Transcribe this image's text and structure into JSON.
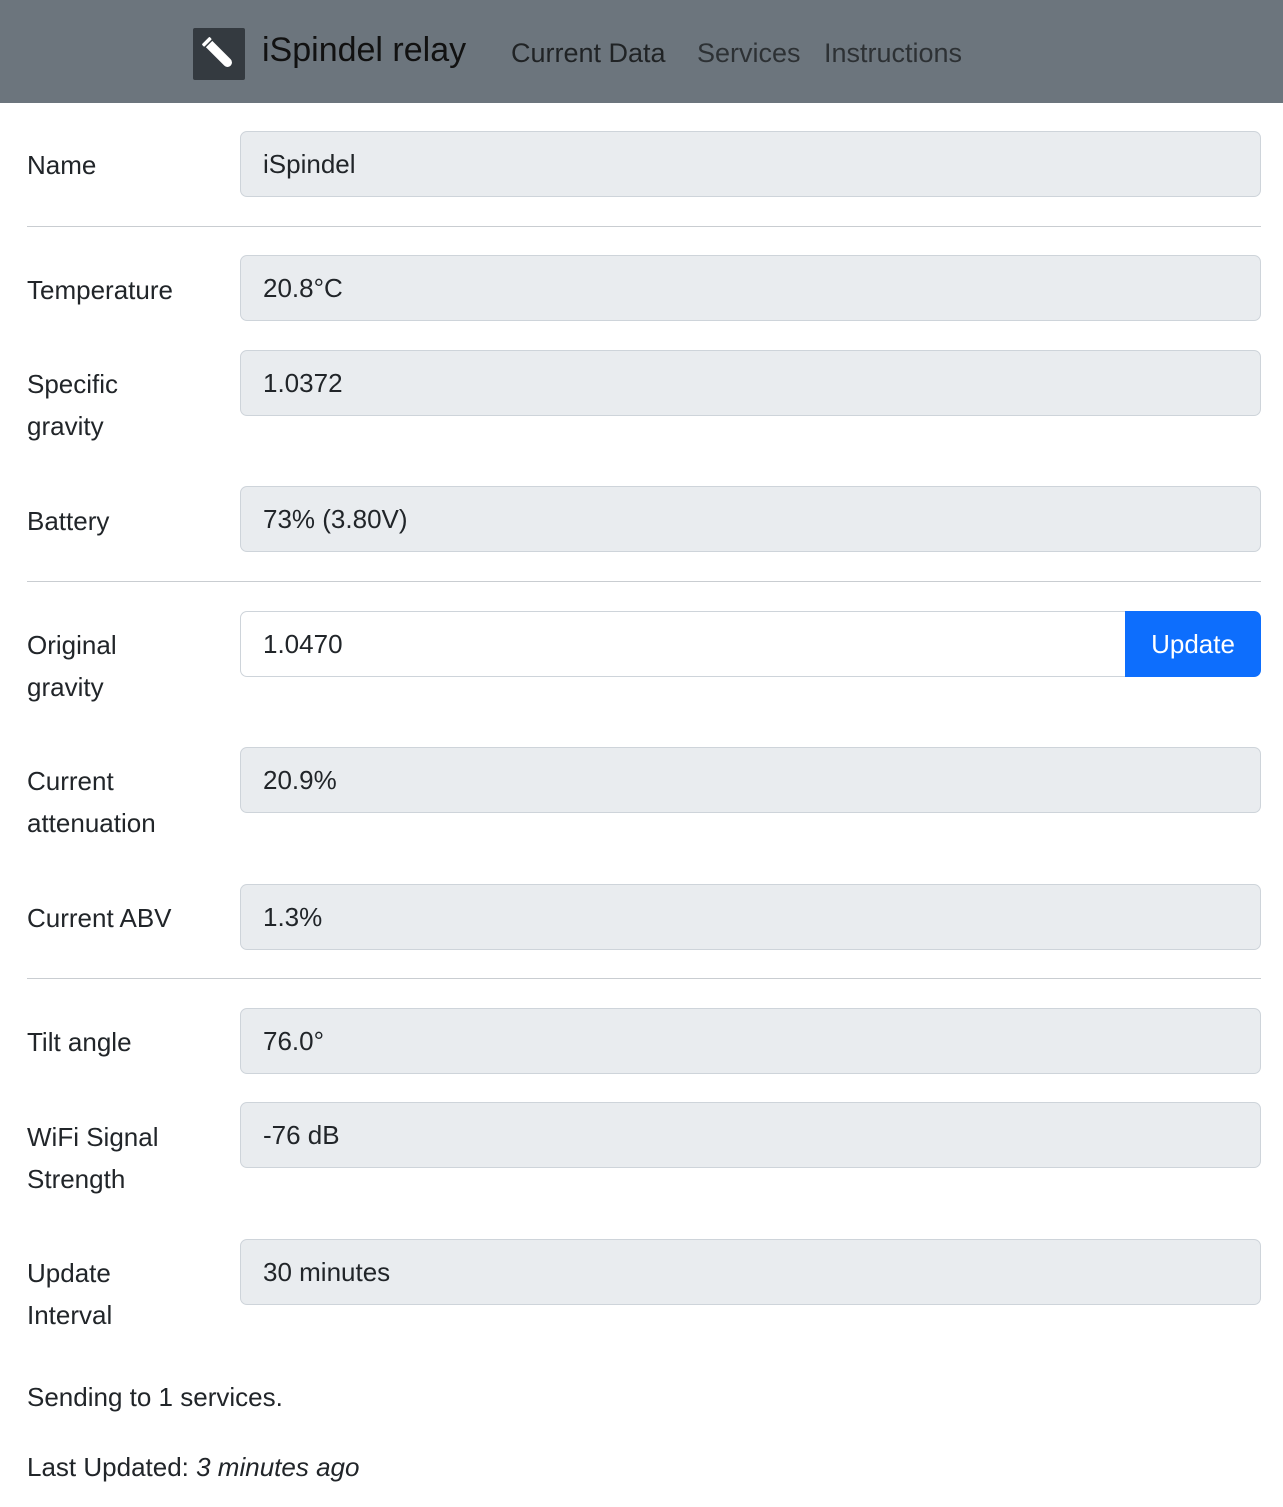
{
  "navbar": {
    "brand": "iSpindel relay",
    "brand_icon": "test-tube-icon",
    "links": [
      "Current Data",
      "Services",
      "Instructions"
    ]
  },
  "fields": {
    "name": {
      "label": "Name",
      "value": "iSpindel"
    },
    "temperature": {
      "label": "Temperature",
      "value": "20.8°C"
    },
    "specific_gravity": {
      "label": "Specific gravity",
      "value": "1.0372"
    },
    "battery": {
      "label": "Battery",
      "value": "73% (3.80V)"
    },
    "original_gravity": {
      "label": "Original gravity",
      "value": "1.0470",
      "button": "Update"
    },
    "current_attenuation": {
      "label": "Current attenuation",
      "value": "20.9%"
    },
    "current_abv": {
      "label": "Current ABV",
      "value": "1.3%"
    },
    "tilt_angle": {
      "label": "Tilt angle",
      "value": "76.0°"
    },
    "wifi_signal": {
      "label": "WiFi Signal Strength",
      "value": "-76 dB"
    },
    "update_interval": {
      "label": "Update Interval",
      "value": "30 minutes"
    }
  },
  "footer": {
    "sending": "Sending to 1 services.",
    "last_updated_label": "Last Updated:",
    "last_updated_value": "3 minutes ago"
  },
  "colors": {
    "navbar_bg": "#6c757d",
    "primary_button": "#0d6efd",
    "readonly_field_bg": "#e9ecef"
  }
}
